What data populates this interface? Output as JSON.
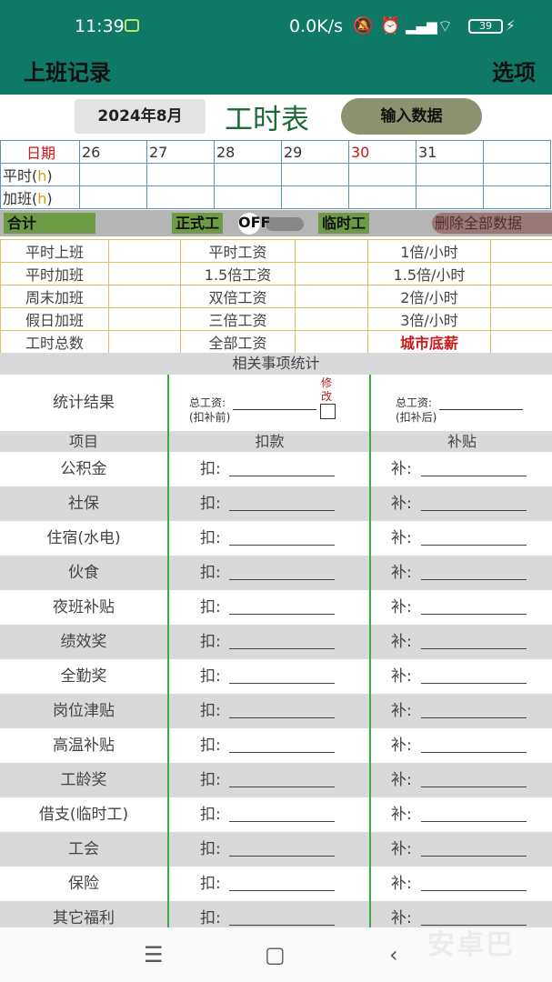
{
  "status_bar": {
    "time": "11:39",
    "network_speed": "0.0K/s",
    "battery": "39",
    "icons": [
      "mute-bell-icon",
      "alarm-icon",
      "hd-signal-icon",
      "wifi-icon",
      "battery-icon",
      "charging-icon"
    ]
  },
  "app_bar": {
    "title": "上班记录",
    "options": "选项"
  },
  "toolbar": {
    "month": "2024年8月",
    "title": "工时表",
    "input_button": "输入数据"
  },
  "day_grid": {
    "date_label": "日期",
    "days": [
      "26",
      "27",
      "28",
      "29",
      "30",
      "31",
      ""
    ],
    "highlight_day": "30",
    "rows": [
      {
        "label": "平时",
        "unit": "h"
      },
      {
        "label": "加班",
        "unit": "h"
      }
    ]
  },
  "total_bar": {
    "total": "合计",
    "regular": "正式工",
    "toggle": "OFF",
    "temp": "临时工",
    "delete": "删除全部数据"
  },
  "summary": [
    [
      "平时上班",
      "",
      "平时工资",
      "",
      "1倍/小时",
      ""
    ],
    [
      "平时加班",
      "",
      "1.5倍工资",
      "",
      "1.5倍/小时",
      ""
    ],
    [
      "周末加班",
      "",
      "双倍工资",
      "",
      "2倍/小时",
      ""
    ],
    [
      "假日加班",
      "",
      "三倍工资",
      "",
      "3倍/小时",
      ""
    ],
    [
      "工时总数",
      "",
      "全部工资",
      "",
      "城市底薪",
      ""
    ]
  ],
  "stats": {
    "header": "相关事项统计",
    "result_label": "统计结果",
    "total_before": "总工资:",
    "before_note": "(扣补前)",
    "edit": "修改",
    "total_after": "总工资:",
    "after_note": "(扣补后)",
    "col_item": "项目",
    "col_deduct": "扣款",
    "col_subsidy": "补贴",
    "deduct_prefix": "扣:",
    "subsidy_prefix": "补:",
    "items": [
      "公积金",
      "社保",
      "住宿(水电)",
      "伙食",
      "夜班补贴",
      "绩效奖",
      "全勤奖",
      "岗位津贴",
      "高温补贴",
      "工龄奖",
      "借支(临时工)",
      "工会",
      "保险",
      "其它福利"
    ]
  },
  "nav_bar": {
    "icons": [
      "menu-icon",
      "home-icon",
      "back-icon"
    ]
  },
  "watermark": "安卓巴",
  "colors": {
    "bar": "#0e7a65",
    "title_green": "#1b6a37",
    "tag_green": "#6c9a45",
    "red": "#d01313",
    "grid_blue": "#5b93b8",
    "grid_yellow": "#e0c060",
    "divider_green": "#43a648"
  }
}
